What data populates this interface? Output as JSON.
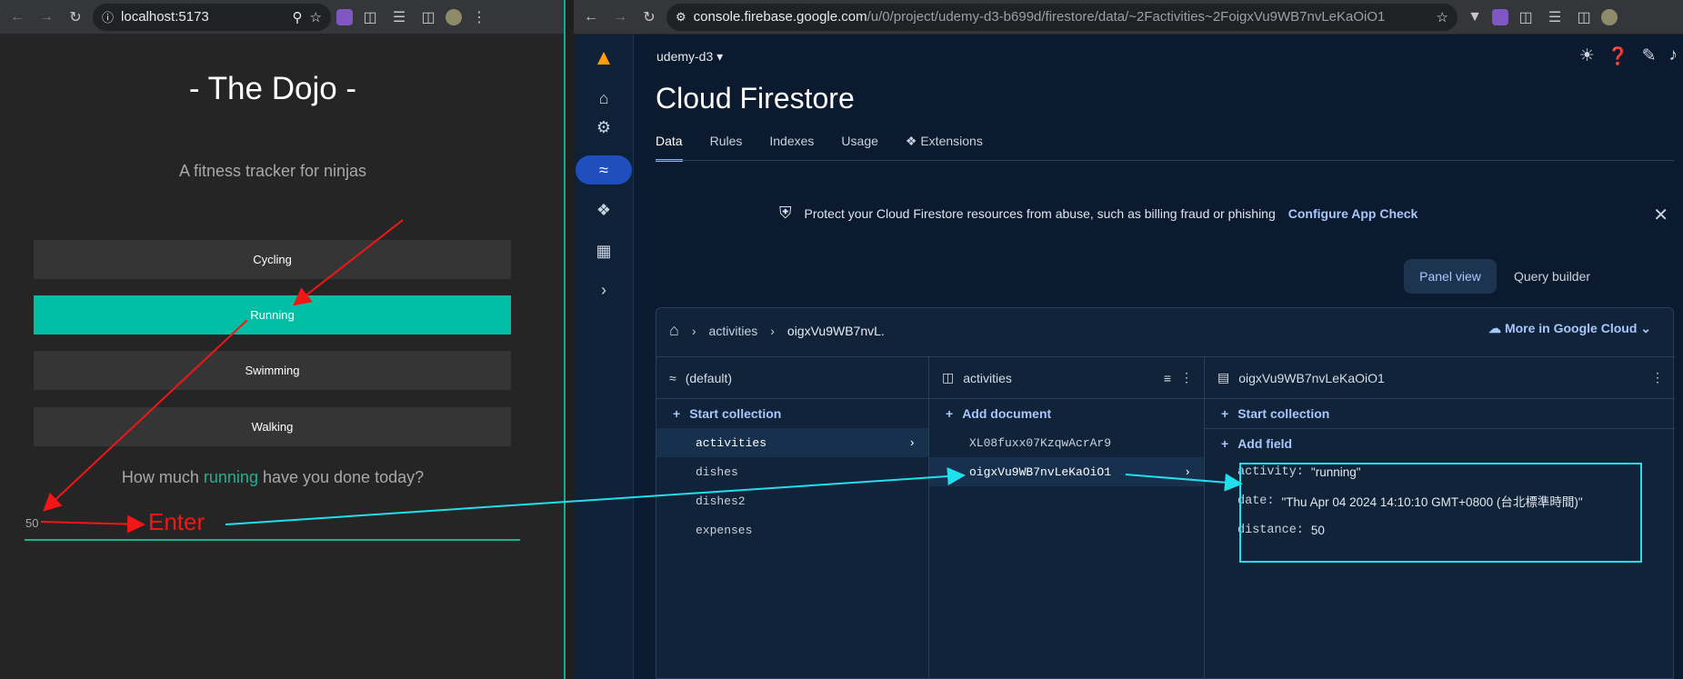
{
  "left_browser": {
    "url": "localhost:5173"
  },
  "dojo": {
    "title": "- The Dojo -",
    "subtitle": "A fitness tracker for ninjas",
    "activities": [
      "Cycling",
      "Running",
      "Swimming",
      "Walking"
    ],
    "selected_activity": "Running",
    "question_prefix": "How much",
    "question_activity": "running",
    "question_suffix": "have you done today?",
    "input_value": "50",
    "annotation_enter": "Enter"
  },
  "right_browser": {
    "url_host": "console.firebase.google.com",
    "url_path": "/u/0/project/udemy-d3-b699d/firestore/data/~2Factivities~2FoigxVu9WB7nvLeKaOiO1"
  },
  "firebase": {
    "project": "udemy-d3",
    "title": "Cloud Firestore",
    "tabs": [
      "Data",
      "Rules",
      "Indexes",
      "Usage",
      "Extensions"
    ],
    "active_tab": "Data",
    "banner_text": "Protect your Cloud Firestore resources from abuse, such as billing fraud or phishing",
    "banner_link": "Configure App Check",
    "view_buttons": {
      "panel": "Panel view",
      "query": "Query builder"
    },
    "breadcrumb": [
      "activities",
      "oigxVu9WB7nvL."
    ],
    "more_link": "More in Google Cloud",
    "col1": {
      "header": "(default)",
      "add": "Start collection",
      "items": [
        "activities",
        "dishes",
        "dishes2",
        "expenses"
      ]
    },
    "col2": {
      "header": "activities",
      "add": "Add document",
      "items": [
        "XL08fuxx07KzqwAcrAr9",
        "oigxVu9WB7nvLeKaOiO1"
      ]
    },
    "col3": {
      "header": "oigxVu9WB7nvLeKaOiO1",
      "add_collection": "Start collection",
      "add_field": "Add field",
      "fields": [
        {
          "key": "activity:",
          "value": "\"running\""
        },
        {
          "key": "date:",
          "value": "\"Thu Apr 04 2024 14:10:10 GMT+0800 (台北標準時間)\""
        },
        {
          "key": "distance:",
          "value": "50"
        }
      ]
    }
  },
  "colors": {
    "accent_teal": "#00bfa5",
    "annotation_red": "#f21616",
    "annotation_cyan": "#21e0ee",
    "firebase_link": "#a8c7fa"
  }
}
